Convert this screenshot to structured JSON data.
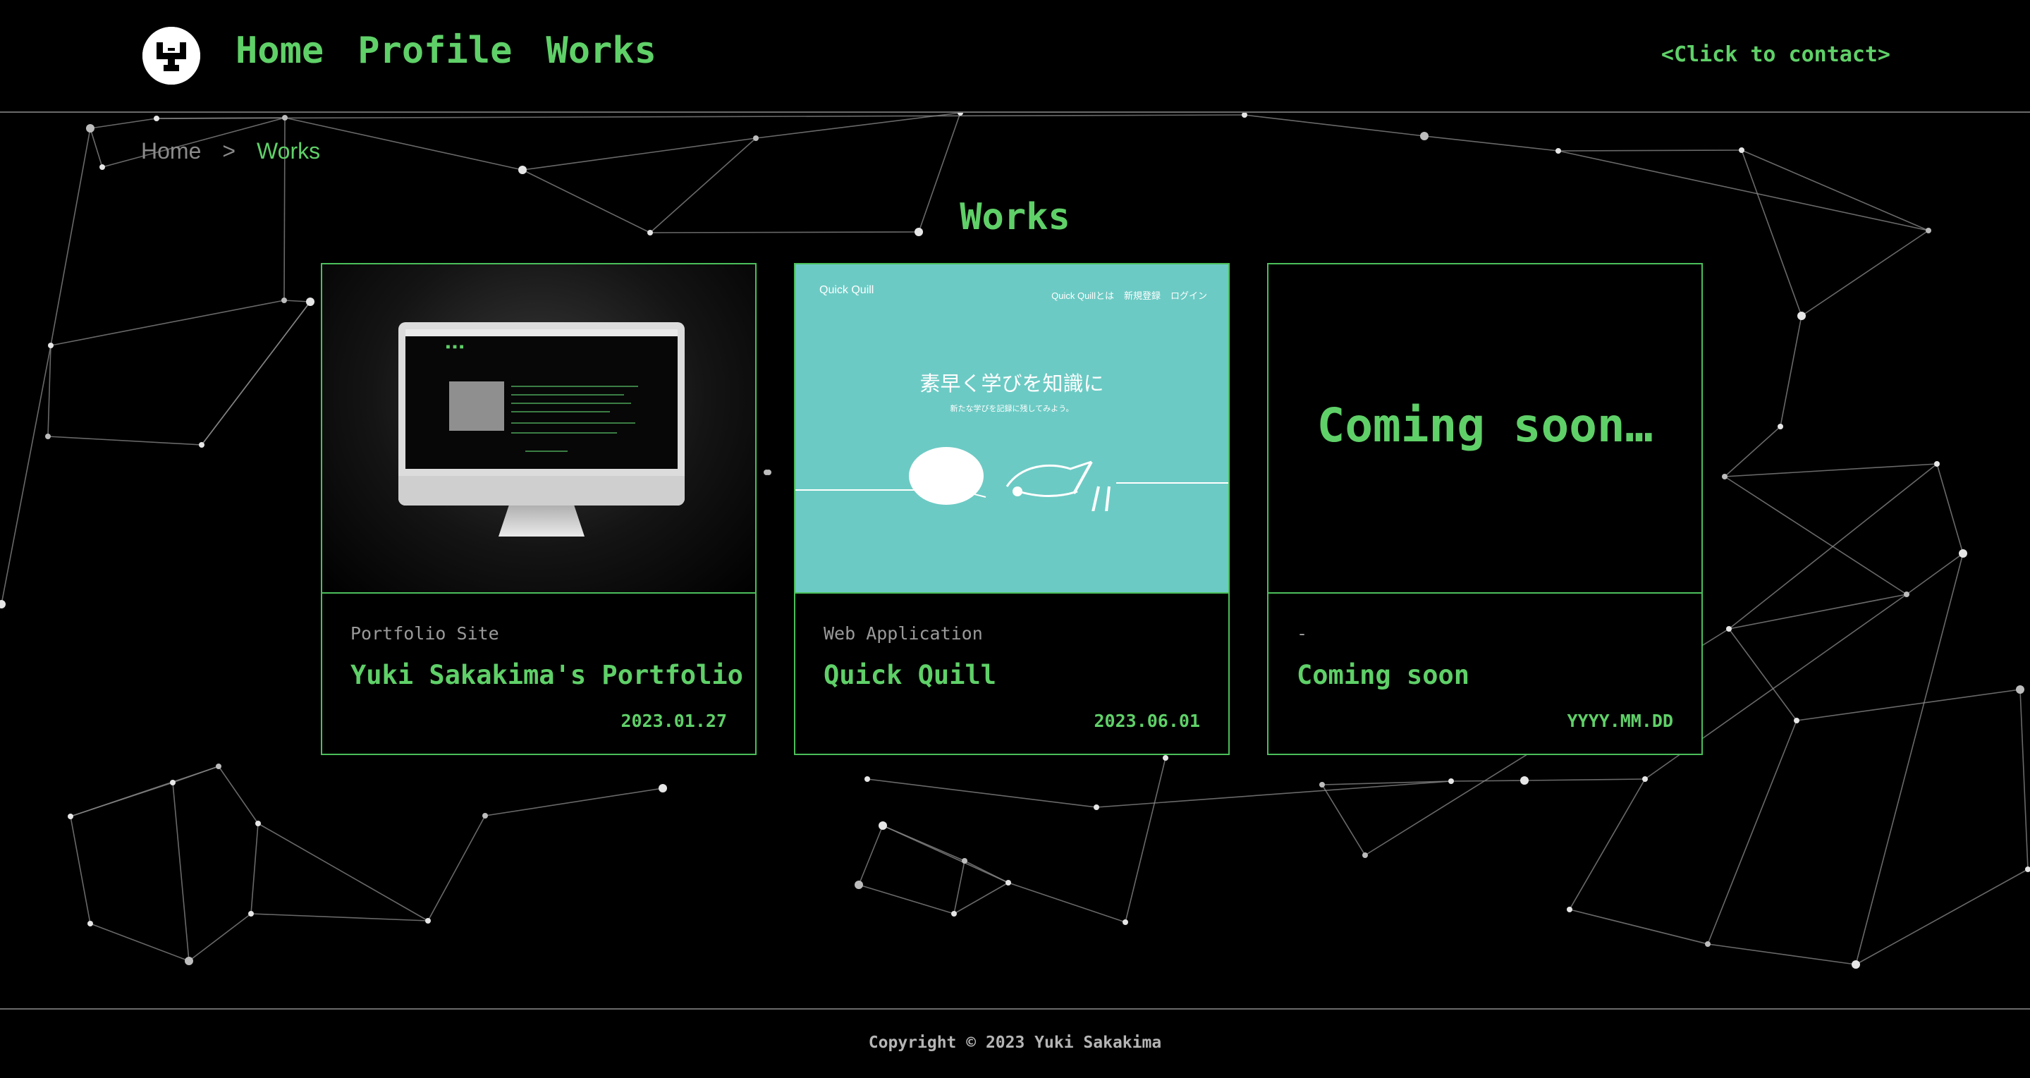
{
  "header": {
    "nav": [
      {
        "label": "Home"
      },
      {
        "label": "Profile"
      },
      {
        "label": "Works"
      }
    ],
    "contact_label": "<Click to contact>"
  },
  "breadcrumb": {
    "home": "Home",
    "separator": ">",
    "current": "Works"
  },
  "page_title": "Works",
  "cards": [
    {
      "thumb": "monitor-mockup",
      "category": "Portfolio Site",
      "title": "Yuki Sakakima's Portfolio",
      "date": "2023.01.27"
    },
    {
      "thumb": "quick-quill-screenshot",
      "category": "Web Application",
      "title": "Quick Quill",
      "date": "2023.06.01",
      "thumb_content": {
        "logo": "Quick Quill",
        "nav": [
          "Quick Quillとは",
          "新規登録",
          "ログイン"
        ],
        "headline": "素早く学びを知識に",
        "subline": "新たな学びを記録に残してみよう。"
      }
    },
    {
      "thumb": "coming-soon",
      "thumb_text": "Coming soon…",
      "category": "-",
      "title": "Coming soon",
      "date": "YYYY.MM.DD"
    }
  ],
  "footer": {
    "copyright": "Copyright © 2023 Yuki Sakakima"
  },
  "colors": {
    "accent": "#5fd068",
    "background": "#000000",
    "card_border": "#4bbf5a",
    "muted_text": "#9a9a9a",
    "quill_teal": "#6ccac4"
  }
}
